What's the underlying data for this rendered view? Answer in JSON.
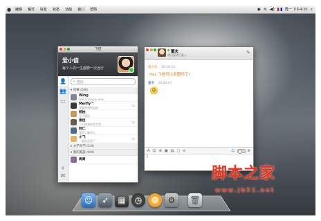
{
  "menubar": {
    "items": [
      "编辑",
      "格式",
      "好友",
      "状态",
      "功能",
      "窗口",
      "帮助"
    ],
    "clock": "周一 下午4:20"
  },
  "contacts_window": {
    "title": "飞信",
    "profile": {
      "name": "爱小信",
      "signature": "每个人的一生都要一次远行"
    },
    "search_placeholder": "查找",
    "groups": [
      {
        "label": "同事 (0/6)",
        "position": "top"
      },
      {
        "label": "大学同学 (1/4)",
        "position": "lower"
      },
      {
        "label": "我的家族 (0/4)",
        "position": "lower"
      }
    ],
    "contacts": [
      {
        "name": "Wing",
        "status": "Life is simply mee",
        "color": "#7b8793"
      },
      {
        "name": "Merfly™",
        "status": "我要梦想的自由",
        "color": "#3a3a3a"
      },
      {
        "name": "杨柏",
        "status": "写了就读",
        "color": "#c89a5a"
      },
      {
        "name": "俊佳",
        "status": "人们吃到的现实是……",
        "color": "#6c5a4c"
      },
      {
        "name": "阿仁",
        "status": "我说了嘛开心",
        "color": "#4a6c8a"
      },
      {
        "name": "小飞",
        "status": "一直在这里了",
        "color": "#e3b66a"
      },
      {
        "name": "周周",
        "status": "",
        "color": "#8a6b9b"
      }
    ]
  },
  "chat_window": {
    "contact_name": "董夫",
    "contact_signature": "明日复明日复入",
    "messages": [
      {
        "sender": "爱小信",
        "time": "16:20:52",
        "text": "Hac 飞信可以发图吗了?"
      },
      {
        "sender": "董夫",
        "time": "16:20:47",
        "text": ""
      }
    ],
    "input_cursor": "I"
  },
  "dock": {
    "icons": [
      "finder-icon",
      "rocket-icon",
      "photo-icon",
      "clock-icon",
      "fetion-icon",
      "system-icon",
      "trash-icon"
    ]
  },
  "watermark": {
    "big": "脚本之家",
    "small": "www.jb51.net"
  },
  "colors": {
    "accent": "#2b8de0",
    "message_orange": "#e07a10",
    "watermark_red": "#e8321e"
  }
}
